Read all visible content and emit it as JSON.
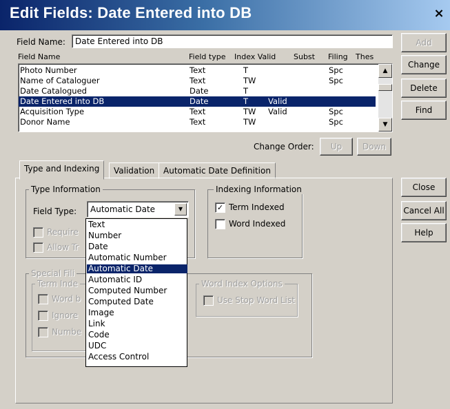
{
  "window": {
    "title": "Edit Fields: Date Entered into DB",
    "close_glyph": "×"
  },
  "field_name": {
    "label": "Field Name:",
    "value": "Date Entered into DB"
  },
  "columns": [
    "Field Name",
    "Field type",
    "Index Valid",
    "Subst",
    "Filing",
    "Thes"
  ],
  "rows": [
    {
      "name": "Photo Number",
      "type": "Text",
      "index": "T",
      "valid": "",
      "filing": "Spc"
    },
    {
      "name": "Name of Cataloguer",
      "type": "Text",
      "index": "TW",
      "valid": "",
      "filing": "Spc"
    },
    {
      "name": "Date Catalogued",
      "type": "Date",
      "index": "T",
      "valid": "",
      "filing": ""
    },
    {
      "name": "Date Entered into DB",
      "type": "Date",
      "index": "T",
      "valid": "Valid",
      "filing": "",
      "selected": true
    },
    {
      "name": "Acquisition Type",
      "type": "Text",
      "index": "TW",
      "valid": "Valid",
      "filing": "Spc"
    },
    {
      "name": "Donor Name",
      "type": "Text",
      "index": "TW",
      "valid": "",
      "filing": "Spc"
    }
  ],
  "change_order": {
    "label": "Change Order:",
    "up": "Up",
    "down": "Down"
  },
  "side_buttons": {
    "add": "Add",
    "change": "Change",
    "delete": "Delete",
    "find": "Find"
  },
  "tabs": [
    "Type and Indexing",
    "Validation",
    "Automatic Date Definition"
  ],
  "type_info": {
    "title": "Type Information",
    "field_type_label": "Field Type:",
    "field_type_value": "Automatic Date",
    "require_label": "Require",
    "allow_label": "Allow Tr"
  },
  "indexing_info": {
    "title": "Indexing Information",
    "term_indexed": "Term Indexed",
    "word_indexed": "Word Indexed"
  },
  "special": {
    "title": "Special Fili",
    "term_index": "Term Inde",
    "word_b": "Word b",
    "ignore": "Ignore",
    "number": "Numbe"
  },
  "word_index_options": {
    "title": "Word Index Options",
    "use_stop": "Use Stop Word List"
  },
  "dropdown_options": [
    "Text",
    "Number",
    "Date",
    "Automatic Number",
    "Automatic Date",
    "Automatic ID",
    "Computed Number",
    "Computed Date",
    "Image",
    "Link",
    "Code",
    "UDC",
    "Access Control"
  ],
  "dropdown_selected_index": 4,
  "bottom_buttons": {
    "close": "Close",
    "cancel_all": "Cancel All",
    "help": "Help"
  }
}
